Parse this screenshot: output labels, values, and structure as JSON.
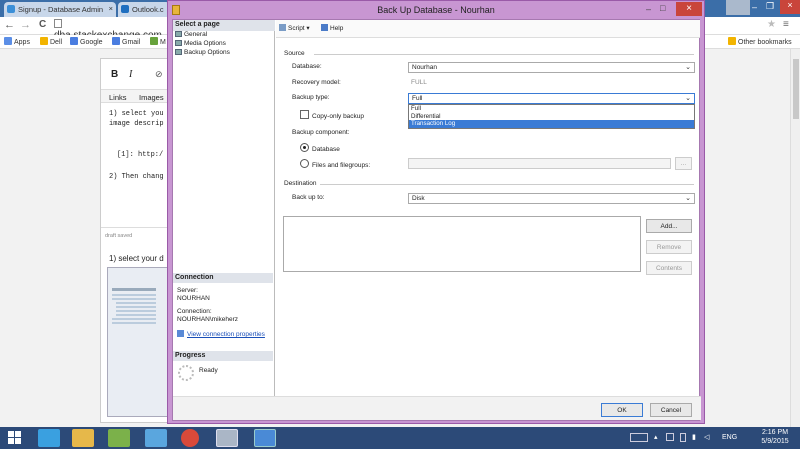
{
  "browser": {
    "tabs": [
      {
        "label": "Signup - Database Admin",
        "close": "×"
      },
      {
        "label": "Outlook.c",
        "close": ""
      }
    ],
    "address": "dba.stackexchange.com",
    "nav": {
      "back": "←",
      "forward": "→",
      "reload": "C",
      "star": "★",
      "menu": "≡"
    },
    "bookmarks": [
      {
        "label": "Apps",
        "color": "#5b8ee6"
      },
      {
        "label": "Dell",
        "color": "#f2b400"
      },
      {
        "label": "Google",
        "color": "#4a7de0"
      },
      {
        "label": "Gmail",
        "color": "#4a7de0"
      },
      {
        "label": "M",
        "color": "#67a23b"
      }
    ],
    "other_bookmarks": "Other bookmarks"
  },
  "editor": {
    "bold": "B",
    "italic": "I",
    "link_icon": "⊘",
    "tab_links": "Links",
    "tab_images": "Images",
    "line1": "1) select you",
    "line2": "image descrip",
    "line3": "[1]: http:/",
    "line4": "2) Then chang",
    "draft_saved": "draft saved",
    "preview": "1) select your d"
  },
  "dialog": {
    "title": "Back Up Database - Nourhan",
    "select_page_header": "Select a page",
    "pages": [
      "General",
      "Media Options",
      "Backup Options"
    ],
    "toolbar": {
      "script": "Script",
      "help": "Help"
    },
    "source_label": "Source",
    "database_label": "Database:",
    "database_value": "Nourhan",
    "recovery_label": "Recovery model:",
    "recovery_value": "FULL",
    "backup_type_label": "Backup type:",
    "backup_type_value": "Full",
    "backup_type_options": [
      "Full",
      "Differential",
      "Transaction Log"
    ],
    "copy_only_label": "Copy-only backup",
    "component_label": "Backup component:",
    "component_database": "Database",
    "component_files": "Files and filegroups:",
    "browse_button": "...",
    "destination_label": "Destination",
    "backup_to_label": "Back up to:",
    "backup_to_value": "Disk",
    "add_button": "Add...",
    "remove_button": "Remove",
    "contents_button": "Contents",
    "connection_header": "Connection",
    "server_label": "Server:",
    "server_value": "NOURHAN",
    "connection_label": "Connection:",
    "connection_value": "NOURHAN\\mikeherz",
    "view_conn_props": "View connection properties",
    "progress_header": "Progress",
    "progress_status": "Ready",
    "ok_button": "OK",
    "cancel_button": "Cancel"
  },
  "taskbar": {
    "language": "ENG",
    "time": "2:16 PM",
    "date": "5/9/2015"
  }
}
